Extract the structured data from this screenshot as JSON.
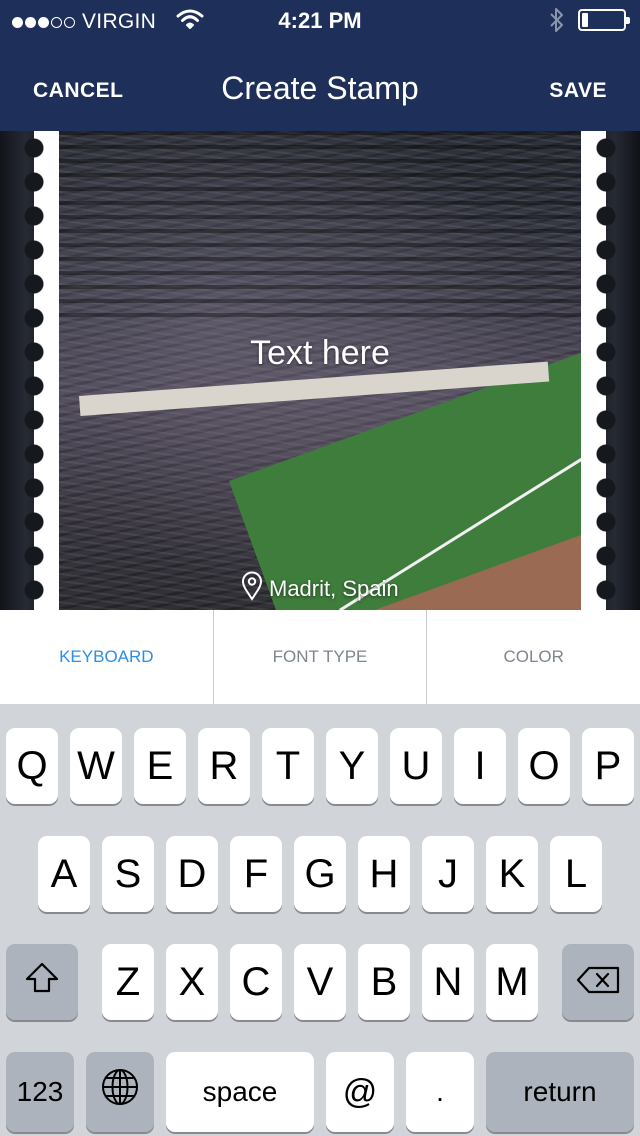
{
  "status_bar": {
    "signal_filled": 3,
    "signal_total": 5,
    "carrier": "VIRGIN",
    "time": "4:21 PM",
    "icons": [
      "wifi-icon",
      "bluetooth-icon",
      "battery-icon"
    ],
    "battery_level": 0.15
  },
  "nav": {
    "cancel": "CANCEL",
    "title": "Create Stamp",
    "save": "SAVE"
  },
  "stamp": {
    "text": "Text here",
    "location": "Madrit, Spain",
    "location_icon": "map-pin-icon"
  },
  "tabs": [
    {
      "label": "KEYBOARD",
      "active": true
    },
    {
      "label": "FONT TYPE",
      "active": false
    },
    {
      "label": "COLOR",
      "active": false
    }
  ],
  "keyboard": {
    "row1": [
      "Q",
      "W",
      "E",
      "R",
      "T",
      "Y",
      "U",
      "I",
      "O",
      "P"
    ],
    "row2": [
      "A",
      "S",
      "D",
      "F",
      "G",
      "H",
      "J",
      "K",
      "L"
    ],
    "row3": [
      "Z",
      "X",
      "C",
      "V",
      "B",
      "N",
      "M"
    ],
    "shift_icon": "shift-icon",
    "delete_icon": "backspace-icon",
    "numbers": "123",
    "globe_icon": "globe-icon",
    "space": "space",
    "at": "@",
    "period": ".",
    "return": "return"
  },
  "colors": {
    "nav_bar": "#1e2f5a",
    "active_tab": "#2b8fe6",
    "inactive_tab": "#7e8591",
    "keyboard_bg": "#d1d4d9"
  }
}
